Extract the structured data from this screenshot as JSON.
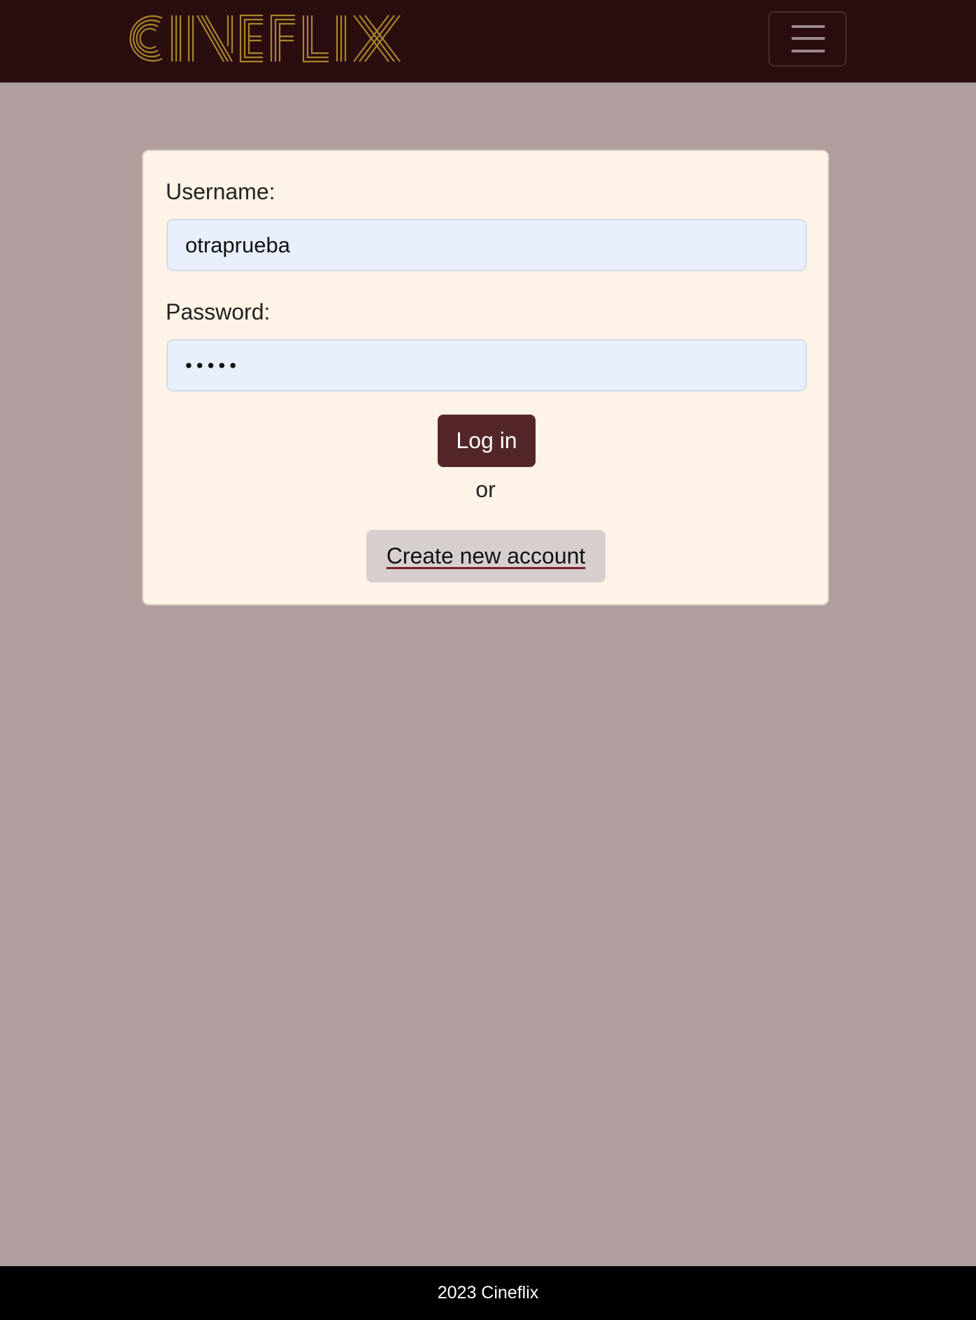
{
  "brand": {
    "name": "CINEFLIX",
    "logo_color": "#a8862e"
  },
  "navbar": {
    "background": "#2a0d0f",
    "menu_icon": "hamburger-menu-icon"
  },
  "login_form": {
    "username_label": "Username:",
    "username_value": "otraprueba",
    "password_label": "Password:",
    "password_value": "•••••",
    "login_label": "Log in",
    "or_text": "or",
    "create_account_label": "Create new account"
  },
  "colors": {
    "page_background": "#b09d9d",
    "card_background": "#fdf3e6",
    "input_background": "#e8effd",
    "primary_button": "#53272a",
    "secondary_button": "#d7cfce"
  },
  "footer": {
    "text": "2023 Cineflix"
  }
}
